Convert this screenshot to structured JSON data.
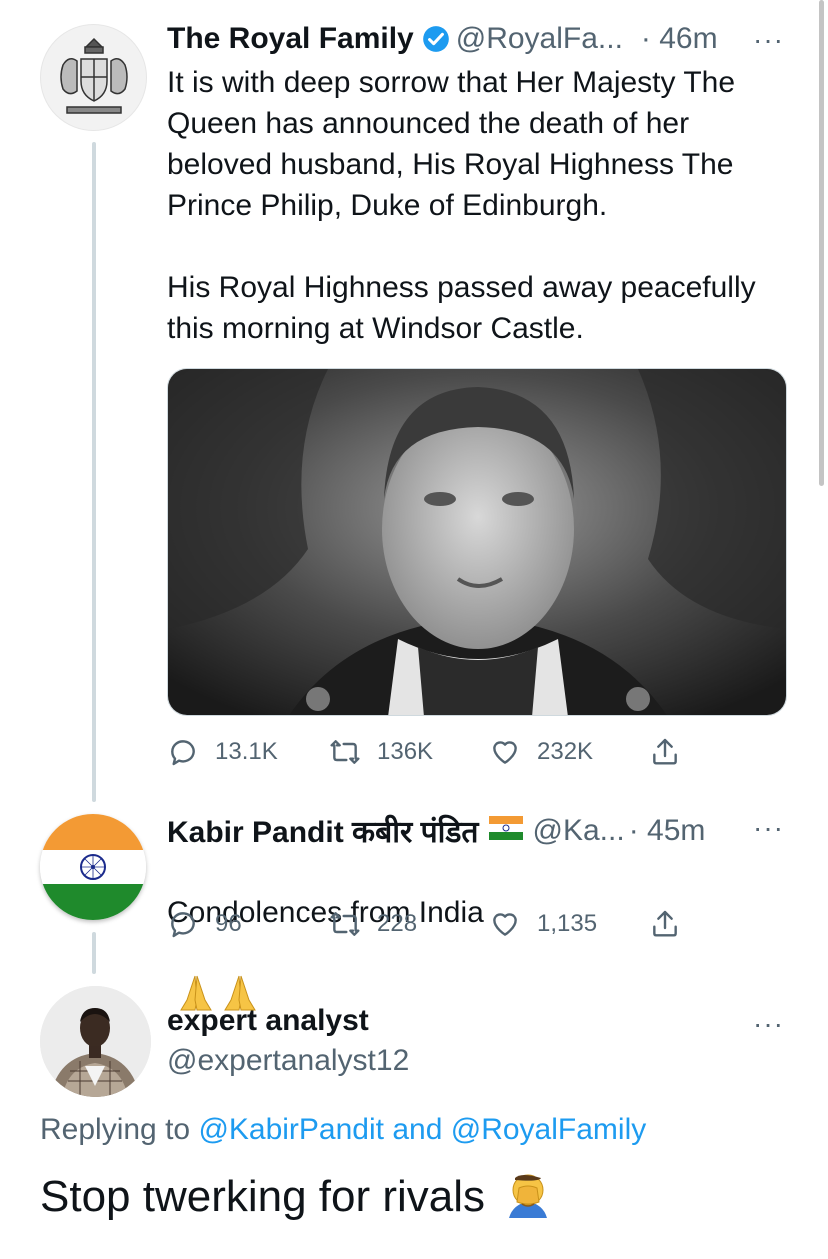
{
  "thread": [
    {
      "author": {
        "name": "The Royal Family",
        "handle": "@RoyalFa...",
        "verified": true,
        "avatar": "royal-crest"
      },
      "time": "· 46m",
      "more": "···",
      "text": "It is with deep sorrow that Her Majesty The Queen has announced the death of her beloved husband, His Royal Highness The Prince Philip, Duke of Edinburgh.\n\nHis Royal Highness passed away peacefully this morning at Windsor Castle.",
      "media": "black-and-white portrait photo",
      "stats": {
        "replies": "13.1K",
        "retweets": "136K",
        "likes": "232K"
      }
    },
    {
      "author": {
        "name": "Kabir Pandit कबीर पंडित",
        "handle": "@Ka...",
        "verified": false,
        "avatar": "india-flag",
        "name_emoji": "india-flag-emoji"
      },
      "time": "· 45m",
      "more": "···",
      "text": "Condolences from India",
      "text_emoji": "folded-hands-emoji",
      "stats": {
        "replies": "96",
        "retweets": "228",
        "likes": "1,135"
      }
    }
  ],
  "reply": {
    "name": "expert analyst",
    "handle": "@expertanalyst12",
    "more": "···",
    "replying_prefix": "Replying to",
    "replying_user1": "@KabirPandit",
    "replying_and": "and",
    "replying_user2": "@RoyalFamily",
    "text": "Stop twerking for rivals",
    "text_emoji": "face-palm-emoji"
  },
  "colors": {
    "accent": "#1d9bf0",
    "secondary_text": "#536471",
    "thread_line": "#cfd9de"
  }
}
